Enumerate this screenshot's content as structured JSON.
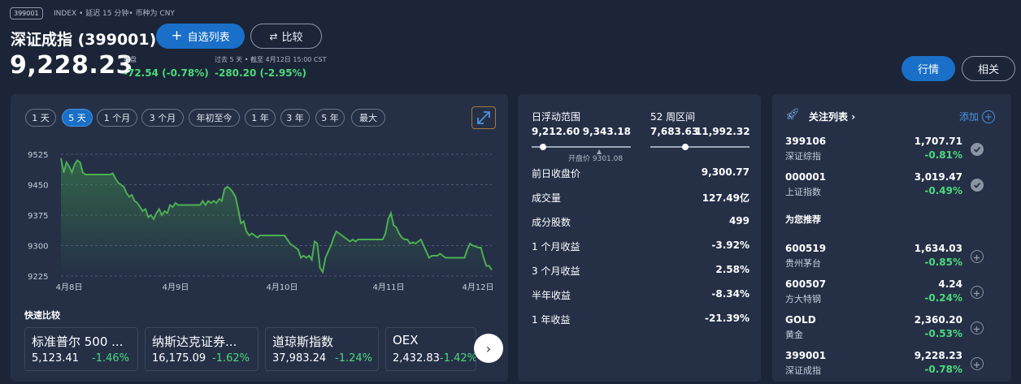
{
  "header": {
    "ticker_badge": "399001",
    "meta": "INDEX • 延迟 15 分钟• 币种为 CNY",
    "title": "深证成指 (399001)",
    "watchlist_button": "自选列表",
    "compare_button": "比较",
    "quote_tab": "行情",
    "related_tab": "相关"
  },
  "quote": {
    "price": "9,228.23",
    "close_label": "收盘",
    "change_today": "-72.54 (-0.78%)",
    "period_label": "过去 5 天 • 截至 4月12日 15:00 CST",
    "change_period": "-280.20 (-2.95%)"
  },
  "chart_ranges": [
    "1 天",
    "5 天",
    "1 个月",
    "3 个月",
    "年初至今",
    "1 年",
    "3 年",
    "5 年",
    "最大"
  ],
  "active_range": "5 天",
  "chart_data": {
    "type": "area",
    "x_ticks": [
      "4月8日",
      "4月9日",
      "4月10日",
      "4月11日",
      "4月12日"
    ],
    "y_ticks": [
      9525,
      9450,
      9375,
      9300,
      9225
    ],
    "ylim": [
      9225,
      9525
    ],
    "grid": true,
    "color": "#4caf50",
    "values": [
      9515,
      9480,
      9505,
      9495,
      9480,
      9500,
      9510,
      9505,
      9480,
      9475,
      9475,
      9475,
      9475,
      9475,
      9475,
      9475,
      9475,
      9475,
      9475,
      9478,
      9465,
      9455,
      9450,
      9445,
      9430,
      9420,
      9425,
      9410,
      9405,
      9395,
      9385,
      9390,
      9370,
      9375,
      9365,
      9380,
      9390,
      9375,
      9385,
      9380,
      9400,
      9395,
      9405,
      9400,
      9400,
      9400,
      9400,
      9400,
      9400,
      9400,
      9400,
      9400,
      9410,
      9400,
      9410,
      9405,
      9410,
      9405,
      9415,
      9410,
      9440,
      9445,
      9440,
      9432,
      9420,
      9390,
      9355,
      9360,
      9335,
      9325,
      9330,
      9325,
      9320,
      9325,
      9325,
      9325,
      9325,
      9325,
      9325,
      9325,
      9325,
      9325,
      9325,
      9315,
      9305,
      9300,
      9295,
      9290,
      9270,
      9275,
      9270,
      9275,
      9265,
      9310,
      9305,
      9245,
      9235,
      9270,
      9285,
      9300,
      9320,
      9335,
      9330,
      9325,
      9320,
      9315,
      9310,
      9315,
      9310,
      9315,
      9315,
      9315,
      9315,
      9315,
      9315,
      9315,
      9315,
      9315,
      9315,
      9330,
      9365,
      9380,
      9350,
      9345,
      9330,
      9320,
      9315,
      9315,
      9305,
      9308,
      9305,
      9310,
      9315,
      9300,
      9285,
      9270,
      9275,
      9275,
      9275,
      9280,
      9275,
      9270,
      9270,
      9270,
      9270,
      9270,
      9270,
      9270,
      9270,
      9290,
      9305,
      9300,
      9298,
      9295,
      9295,
      9270,
      9250,
      9250,
      9240
    ]
  },
  "quick_compare": {
    "title": "快速比较",
    "items": [
      {
        "name": "标准普尔 500 ...",
        "price": "5,123.41",
        "change": "-1.46%"
      },
      {
        "name": "纳斯达克证券...",
        "price": "16,175.09",
        "change": "-1.62%"
      },
      {
        "name": "道琼斯指数",
        "price": "37,983.24",
        "change": "-1.24%"
      },
      {
        "name": "OEX",
        "price": "2,432.83",
        "change": "-1.42%"
      }
    ]
  },
  "stats": {
    "day_range_label": "日浮动范围",
    "day_low": "9,212.60",
    "day_high": "9,343.18",
    "open_label": "开盘价 9301.08",
    "week52_label": "52 周区间",
    "week52_low": "7,683.63",
    "week52_high": "11,992.32",
    "rows": [
      {
        "label": "前日收盘价",
        "value": "9,300.77"
      },
      {
        "label": "成交量",
        "value": "127.49亿"
      },
      {
        "label": "成分股数",
        "value": "499"
      },
      {
        "label": "1 个月收益",
        "value": "-3.92%"
      },
      {
        "label": "3 个月收益",
        "value": "2.58%"
      },
      {
        "label": "半年收益",
        "value": "-8.34%"
      },
      {
        "label": "1 年收益",
        "value": "-21.39%"
      }
    ]
  },
  "watchlist": {
    "title": "关注列表",
    "add_label": "添加",
    "followed": [
      {
        "code": "399106",
        "name": "深证综指",
        "price": "1,707.71",
        "change": "-0.81%"
      },
      {
        "code": "000001",
        "name": "上证指数",
        "price": "3,019.47",
        "change": "-0.49%"
      }
    ],
    "recommend_title": "为您推荐",
    "recommended": [
      {
        "code": "600519",
        "name": "贵州茅台",
        "price": "1,634.03",
        "change": "-0.85%"
      },
      {
        "code": "600507",
        "name": "方大特钢",
        "price": "4.24",
        "change": "-0.24%"
      },
      {
        "code": "GOLD",
        "name": "黄金",
        "price": "2,360.20",
        "change": "-0.53%"
      },
      {
        "code": "399001",
        "name": "深证成指",
        "price": "9,228.23",
        "change": "-0.78%"
      }
    ]
  }
}
